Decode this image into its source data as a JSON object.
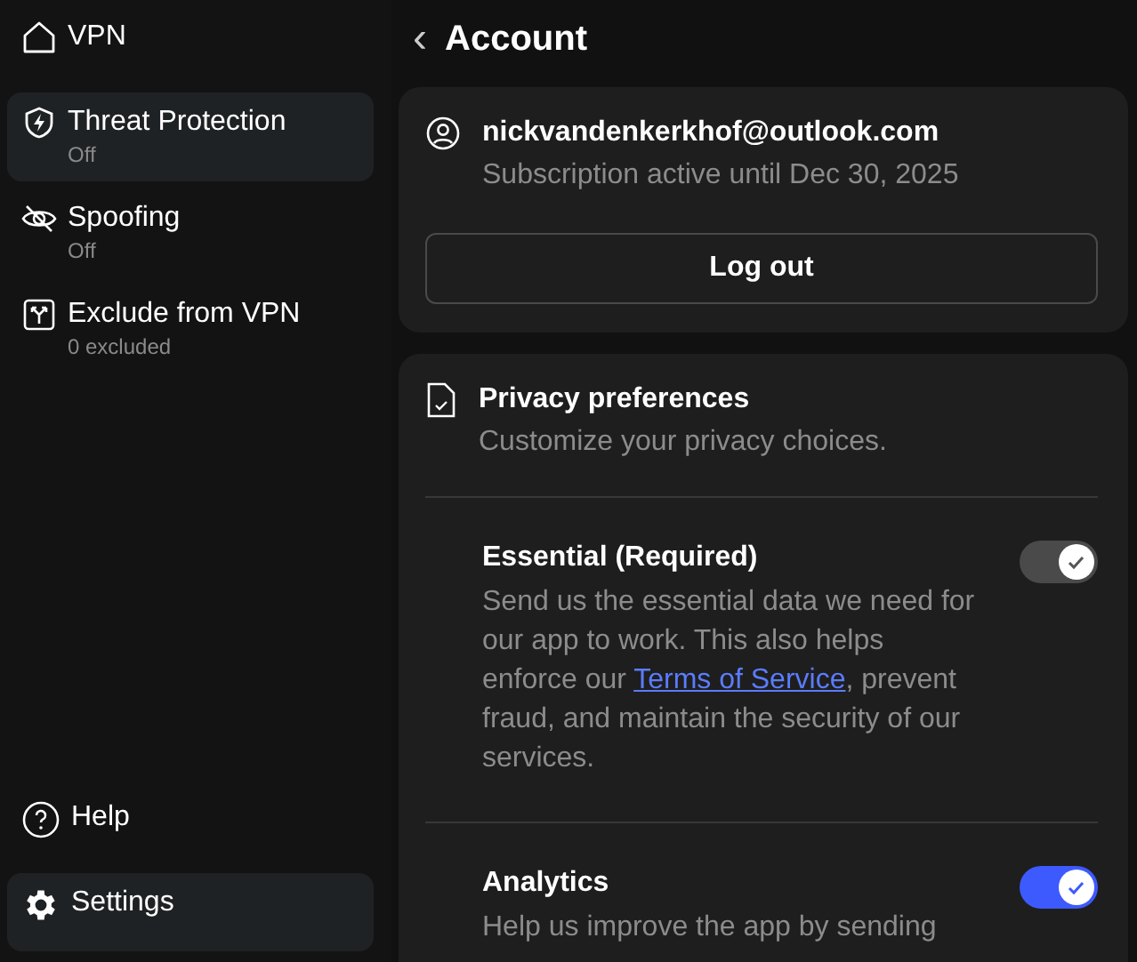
{
  "sidebar": {
    "items": [
      {
        "label": "VPN",
        "selected": false
      },
      {
        "label": "Threat Protection",
        "sublabel": "Off",
        "selected": true
      },
      {
        "label": "Spoofing",
        "sublabel": "Off",
        "selected": false
      },
      {
        "label": "Exclude from VPN",
        "sublabel": "0 excluded",
        "selected": false
      }
    ],
    "bottom_items": [
      {
        "label": "Help",
        "selected": false
      },
      {
        "label": "Settings",
        "selected": true
      }
    ]
  },
  "header": {
    "back": "‹",
    "title": "Account"
  },
  "account": {
    "email": "nickvandenkerkhof@outlook.com",
    "subscription": "Subscription active until Dec 30, 2025",
    "logout_button": "Log out"
  },
  "privacy": {
    "title": "Privacy preferences",
    "subtitle": "Customize your privacy choices.",
    "options": [
      {
        "title": "Essential (Required)",
        "description": "Send us the essential data we need for our app to work. This also helps enforce our ",
        "link": "Terms of Service",
        "description_end": ", prevent fraud, and maintain the security of our services.",
        "on": true,
        "disabled": true
      },
      {
        "title": "Analytics",
        "description": "Help us improve the app by sending",
        "on": true,
        "disabled": false
      }
    ]
  }
}
